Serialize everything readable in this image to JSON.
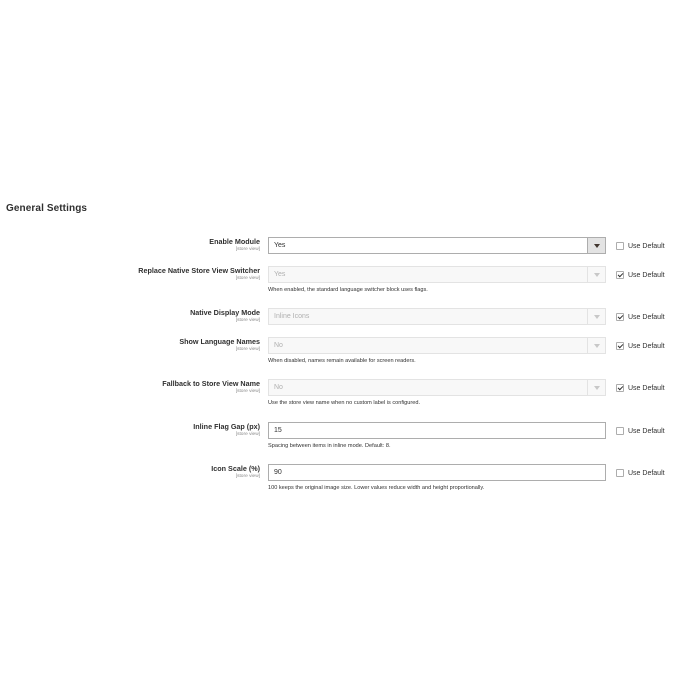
{
  "section": {
    "title": "General Settings"
  },
  "fields": [
    {
      "label": "Enable Module",
      "scope": "[store view]",
      "value": "Yes",
      "type": "select",
      "disabled": false,
      "use_default": false,
      "use_default_label": "Use Default",
      "note": ""
    },
    {
      "label": "Replace Native Store View Switcher",
      "scope": "[store view]",
      "value": "Yes",
      "type": "select",
      "disabled": true,
      "use_default": true,
      "use_default_label": "Use Default",
      "note": "When enabled, the standard language switcher block uses flags."
    },
    {
      "label": "Native Display Mode",
      "scope": "[store view]",
      "value": "Inline Icons",
      "type": "select",
      "disabled": true,
      "use_default": true,
      "use_default_label": "Use Default",
      "note": ""
    },
    {
      "label": "Show Language Names",
      "scope": "[store view]",
      "value": "No",
      "type": "select",
      "disabled": true,
      "use_default": true,
      "use_default_label": "Use Default",
      "note": "When disabled, names remain available for screen readers."
    },
    {
      "label": "Fallback to Store View Name",
      "scope": "[store view]",
      "value": "No",
      "type": "select",
      "disabled": true,
      "use_default": true,
      "use_default_label": "Use Default",
      "note": "Use the store view name when no custom label is configured."
    },
    {
      "label": "Inline Flag Gap (px)",
      "scope": "[store view]",
      "value": "15",
      "type": "text",
      "disabled": false,
      "use_default": false,
      "use_default_label": "Use Default",
      "note": "Spacing between items in inline mode. Default: 8."
    },
    {
      "label": "Icon Scale (%)",
      "scope": "[store view]",
      "value": "90",
      "type": "text",
      "disabled": false,
      "use_default": false,
      "use_default_label": "Use Default",
      "note": "100 keeps the original image size. Lower values reduce width and height proportionally."
    }
  ]
}
